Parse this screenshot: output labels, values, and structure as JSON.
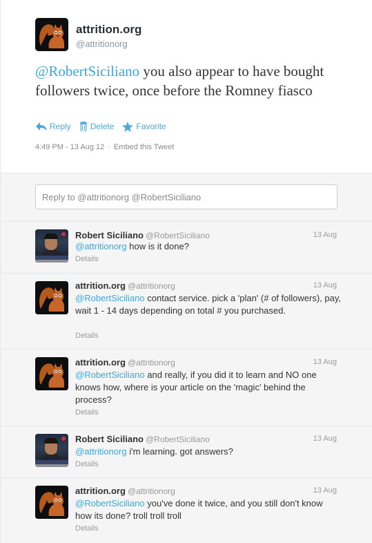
{
  "colors": {
    "link": "#3aa8da",
    "action": "#4fa8d8",
    "muted": "#999999",
    "reply_bg": "#f5f5f5"
  },
  "main_tweet": {
    "name": "attrition.org",
    "handle": "@attritionorg",
    "avatar_icon": "squirrel-logo-icon",
    "mention": "@RobertSiciliano",
    "text": " you also appear to have bought followers twice, once before the Romney fiasco",
    "actions": {
      "reply": "Reply",
      "delete": "Delete",
      "favorite": "Favorite"
    },
    "timestamp": "4:49 PM - 13 Aug 12",
    "embed": "Embed this Tweet"
  },
  "reply_box": {
    "placeholder": "Reply to @attritionorg @RobertSiciliano"
  },
  "replies": [
    {
      "name": "Robert Siciliano",
      "handle": "@RobertSiciliano",
      "time": "13 Aug",
      "mention": "@attritionorg",
      "text": " how is it done?",
      "details": "Details",
      "avatar": "photo"
    },
    {
      "name": "attrition.org",
      "handle": "@attritionorg",
      "time": "13 Aug",
      "mention": "@RobertSiciliano",
      "text": " contact service. pick a 'plan' (# of followers), pay, wait 1 - 14 days depending on total # you purchased.",
      "details": "Details",
      "avatar": "squirrel"
    },
    {
      "name": "attrition.org",
      "handle": "@attritionorg",
      "time": "13 Aug",
      "mention": "@RobertSiciliano",
      "text": " and really, if you did it to learn and NO one knows how, where is your article on the 'magic' behind the process?",
      "details": "Details",
      "avatar": "squirrel"
    },
    {
      "name": "Robert Siciliano",
      "handle": "@RobertSiciliano",
      "time": "13 Aug",
      "mention": "@attritionorg",
      "text": " i'm learning. got answers?",
      "details": "Details",
      "avatar": "photo"
    },
    {
      "name": "attrition.org",
      "handle": "@attritionorg",
      "time": "13 Aug",
      "mention": "@RobertSiciliano",
      "text": " you've done it twice, and you still don't know how its done? troll troll troll",
      "details": "Details",
      "avatar": "squirrel"
    }
  ]
}
